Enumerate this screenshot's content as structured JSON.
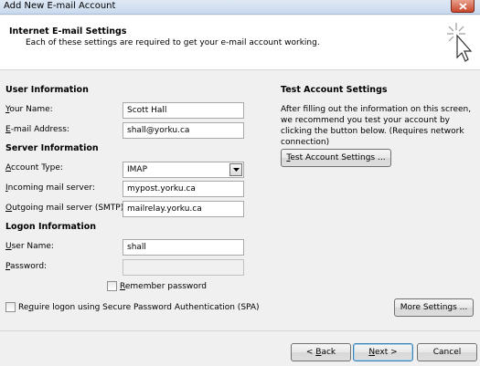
{
  "window": {
    "title": "Add New E-mail Account"
  },
  "header": {
    "title": "Internet E-mail Settings",
    "subtitle": "Each of these settings are required to get your e-mail account working."
  },
  "user_info": {
    "section": "User Information",
    "your_name": {
      "label_key": "Y",
      "label_rest": "our Name:",
      "value": "Scott Hall"
    },
    "email": {
      "label_key": "E",
      "label_rest": "-mail Address:",
      "value": "shall@yorku.ca"
    }
  },
  "server_info": {
    "section": "Server Information",
    "account_type": {
      "label_pre": "",
      "label_key": "A",
      "label_rest": "ccount Type:",
      "value": "IMAP"
    },
    "incoming": {
      "label_key": "I",
      "label_rest": "ncoming mail server:",
      "value": "mypost.yorku.ca"
    },
    "outgoing": {
      "label_key": "O",
      "label_rest": "utgoing mail server (SMTP):",
      "value": "mailrelay.yorku.ca"
    }
  },
  "logon_info": {
    "section": "Logon Information",
    "user_name": {
      "label_key": "U",
      "label_rest": "ser Name:",
      "value": "shall"
    },
    "password": {
      "label_key": "P",
      "label_rest": "assword:",
      "value": ""
    },
    "remember": {
      "label_key": "R",
      "label_rest": "emember password",
      "checked": false
    },
    "spa": {
      "label_pre": "Re",
      "label_key": "q",
      "label_rest": "uire logon using Secure Password Authentication (SPA)",
      "checked": false
    }
  },
  "test": {
    "section": "Test Account Settings",
    "description": "After filling out the information on this screen, we recommend you test your account by clicking the button below. (Requires network connection)",
    "button_key": "T",
    "button_rest": "est Account Settings ..."
  },
  "buttons": {
    "more_settings": "More Settings ...",
    "back_pre": "< ",
    "back_key": "B",
    "back_rest": "ack",
    "next_key": "N",
    "next_rest": "ext >",
    "cancel": "Cancel"
  }
}
